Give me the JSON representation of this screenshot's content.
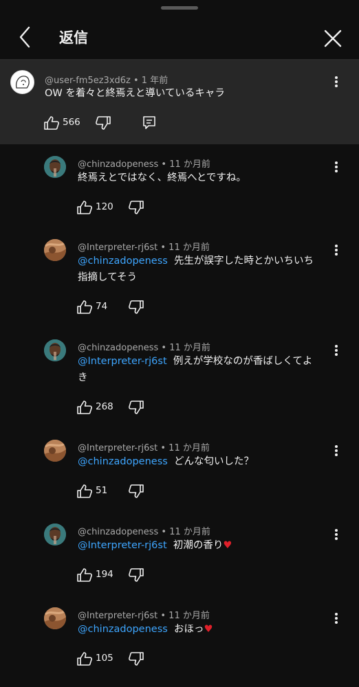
{
  "header": {
    "title": "返信"
  },
  "top_comment": {
    "author": "@user-fm5ez3xd6z",
    "time": "1 年前",
    "text": "OW を着々と終焉えと導いているキャラ",
    "likes": "566"
  },
  "replies": [
    {
      "author": "@chinzadopeness",
      "time": "11 か月前",
      "mention": "",
      "text": "終焉えとではなく、終焉へとですね。",
      "likes": "120",
      "avatar": "chin"
    },
    {
      "author": "@Interpreter-rj6st",
      "time": "11 か月前",
      "mention": "@chinzadopeness",
      "text": "先生が誤字した時とかいちいち",
      "text2": "指摘してそう",
      "likes": "74",
      "avatar": "interp"
    },
    {
      "author": "@chinzadopeness",
      "time": "11 か月前",
      "mention": "@Interpreter-rj6st",
      "text": "例えが学校なのが香ばしくてよ",
      "text2": "き",
      "likes": "268",
      "avatar": "chin"
    },
    {
      "author": "@Interpreter-rj6st",
      "time": "11 か月前",
      "mention": "@chinzadopeness",
      "text": "どんな匂いした？",
      "likes": "51",
      "avatar": "interp"
    },
    {
      "author": "@chinzadopeness",
      "time": "11 か月前",
      "mention": "@Interpreter-rj6st",
      "text": "初潮の香り♥",
      "likes": "194",
      "avatar": "chin"
    },
    {
      "author": "@Interpreter-rj6st",
      "time": "11 か月前",
      "mention": "@chinzadopeness",
      "text": "おほっ♥",
      "likes": "105",
      "avatar": "interp"
    }
  ],
  "colors": {
    "background": "#0f0f0f",
    "highlight": "#272727",
    "mention": "#3ea6ff",
    "heart": "#e0202a"
  },
  "icons": [
    "back-arrow-icon",
    "close-icon",
    "more-vert-icon",
    "thumb-up-icon",
    "thumb-down-icon",
    "reply-icon"
  ]
}
